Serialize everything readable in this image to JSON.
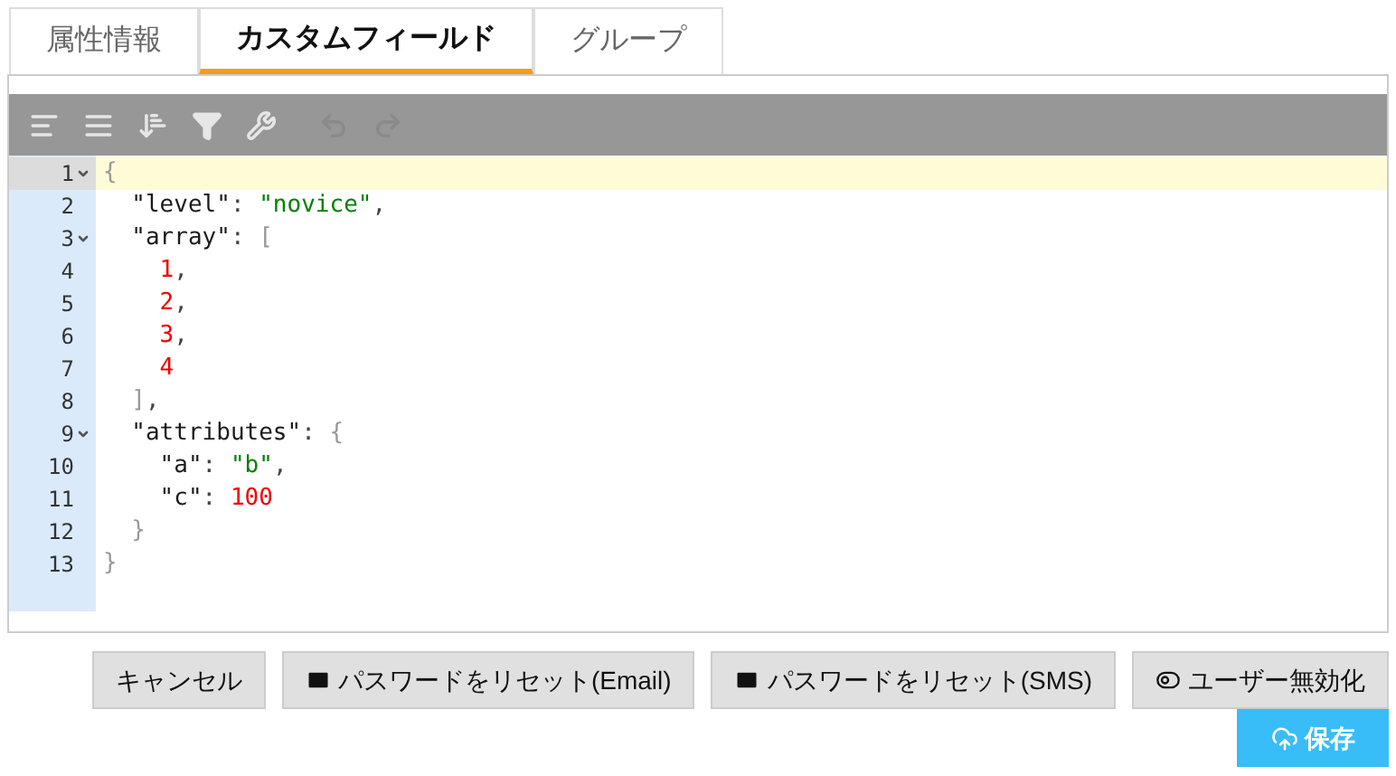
{
  "tabs": [
    {
      "label": "属性情報",
      "selected": false
    },
    {
      "label": "カスタムフィールド",
      "selected": true
    },
    {
      "label": "グループ",
      "selected": false
    }
  ],
  "toolbar": [
    {
      "kind": "format",
      "disabled": false
    },
    {
      "kind": "compact",
      "disabled": false
    },
    {
      "kind": "sort",
      "disabled": false
    },
    {
      "kind": "filter",
      "disabled": false
    },
    {
      "kind": "repair",
      "disabled": false
    },
    {
      "kind": "undo",
      "disabled": true
    },
    {
      "kind": "redo",
      "disabled": true
    }
  ],
  "code_lines": [
    {
      "number": "1",
      "foldable": true,
      "active": true,
      "tokens": [
        {
          "kind": "bracket",
          "text": "{"
        }
      ]
    },
    {
      "number": "2",
      "foldable": false,
      "active": false,
      "tokens": [
        {
          "kind": "key",
          "text": "  \"level\""
        },
        {
          "kind": "punct",
          "text": ": "
        },
        {
          "kind": "string",
          "text": "\"novice\""
        },
        {
          "kind": "punct",
          "text": ","
        }
      ]
    },
    {
      "number": "3",
      "foldable": true,
      "active": false,
      "tokens": [
        {
          "kind": "key",
          "text": "  \"array\""
        },
        {
          "kind": "punct",
          "text": ": "
        },
        {
          "kind": "bracket",
          "text": "["
        }
      ]
    },
    {
      "number": "4",
      "foldable": false,
      "active": false,
      "tokens": [
        {
          "kind": "number",
          "text": "    1"
        },
        {
          "kind": "punct",
          "text": ","
        }
      ]
    },
    {
      "number": "5",
      "foldable": false,
      "active": false,
      "tokens": [
        {
          "kind": "number",
          "text": "    2"
        },
        {
          "kind": "punct",
          "text": ","
        }
      ]
    },
    {
      "number": "6",
      "foldable": false,
      "active": false,
      "tokens": [
        {
          "kind": "number",
          "text": "    3"
        },
        {
          "kind": "punct",
          "text": ","
        }
      ]
    },
    {
      "number": "7",
      "foldable": false,
      "active": false,
      "tokens": [
        {
          "kind": "number",
          "text": "    4"
        }
      ]
    },
    {
      "number": "8",
      "foldable": false,
      "active": false,
      "tokens": [
        {
          "kind": "bracket",
          "text": "  ]"
        },
        {
          "kind": "punct",
          "text": ","
        }
      ]
    },
    {
      "number": "9",
      "foldable": true,
      "active": false,
      "tokens": [
        {
          "kind": "key",
          "text": "  \"attributes\""
        },
        {
          "kind": "punct",
          "text": ": "
        },
        {
          "kind": "bracket",
          "text": "{"
        }
      ]
    },
    {
      "number": "10",
      "foldable": false,
      "active": false,
      "tokens": [
        {
          "kind": "key",
          "text": "    \"a\""
        },
        {
          "kind": "punct",
          "text": ": "
        },
        {
          "kind": "string",
          "text": "\"b\""
        },
        {
          "kind": "punct",
          "text": ","
        }
      ]
    },
    {
      "number": "11",
      "foldable": false,
      "active": false,
      "tokens": [
        {
          "kind": "key",
          "text": "    \"c\""
        },
        {
          "kind": "punct",
          "text": ": "
        },
        {
          "kind": "number",
          "text": "100"
        }
      ]
    },
    {
      "number": "12",
      "foldable": false,
      "active": false,
      "tokens": [
        {
          "kind": "bracket",
          "text": "  }"
        }
      ]
    },
    {
      "number": "13",
      "foldable": false,
      "active": false,
      "tokens": [
        {
          "kind": "bracket",
          "text": "}"
        }
      ]
    }
  ],
  "buttons": [
    {
      "label": "キャンセル",
      "kind": "plain"
    },
    {
      "label": "パスワードをリセット(Email)",
      "kind": "mail"
    },
    {
      "label": "パスワードをリセット(SMS)",
      "kind": "mail"
    },
    {
      "label": "ユーザー無効化",
      "kind": "toggle"
    }
  ],
  "save_button": {
    "label": "保存"
  }
}
